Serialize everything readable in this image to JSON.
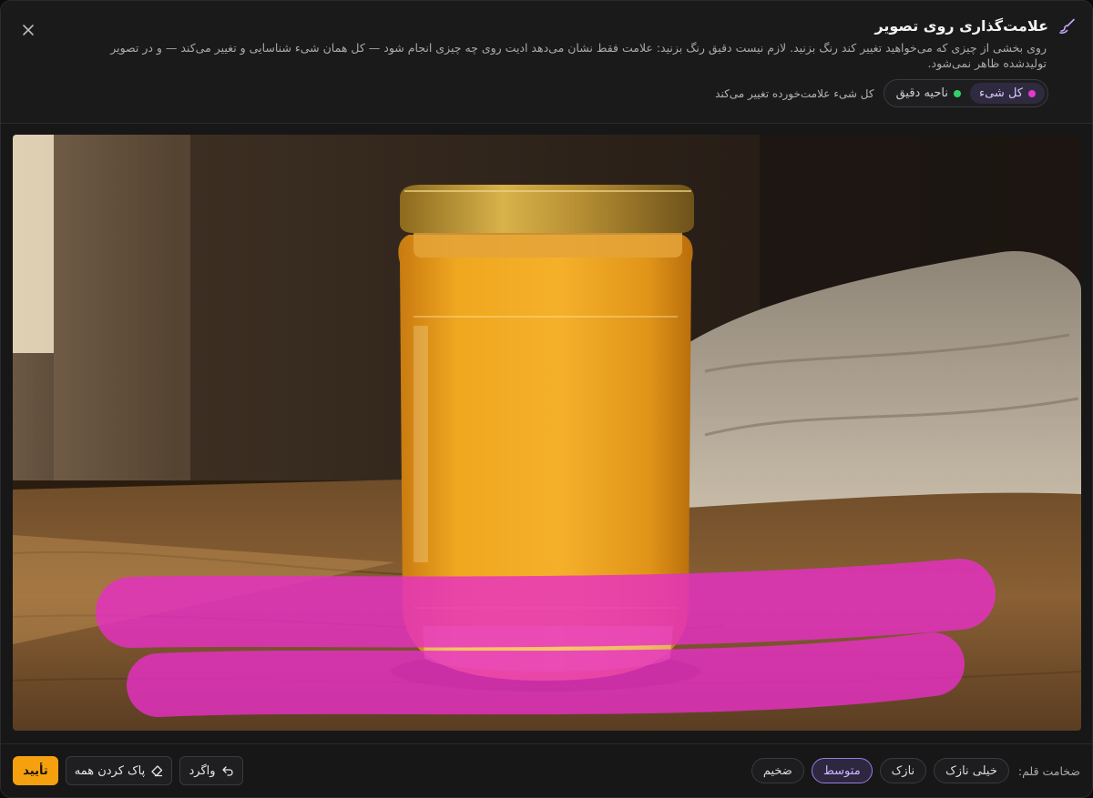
{
  "header": {
    "title": "علامت‌گذاری روی تصویر",
    "description": "روی بخشی از چیزی که می‌خواهید تغییر کند رنگ بزنید. لازم نیست دقیق رنگ بزنید: علامت فقط نشان می‌دهد ادیت روی چه چیزی انجام شود — کل همان شیء شناسایی و تغییر می‌کند — و در تصویر تولیدشده ظاهر نمی‌شود.",
    "close_icon": "close-icon",
    "title_icon": "brush-icon"
  },
  "mode": {
    "options": [
      {
        "label": "کل شیء",
        "color": "#e23ad0",
        "active": true
      },
      {
        "label": "ناحیه دقیق",
        "color": "#33d16a",
        "active": false
      }
    ],
    "hint": "کل شیء علامت‌خورده تغییر می‌کند"
  },
  "footer": {
    "confirm_label": "تأیید",
    "clear_label": "پاک کردن همه",
    "clear_icon": "eraser-icon",
    "undo_label": "واگرد",
    "undo_icon": "undo-icon",
    "pen_label": "ضخامت قلم:",
    "pen_sizes": [
      {
        "label": "خیلی نازک",
        "active": false
      },
      {
        "label": "نازک",
        "active": false
      },
      {
        "label": "متوسط",
        "active": true
      },
      {
        "label": "ضخیم",
        "active": false
      }
    ]
  },
  "colors": {
    "accent": "#f5a10f",
    "mark": "#e62fc4",
    "active_pill": "#9a7ce0"
  }
}
